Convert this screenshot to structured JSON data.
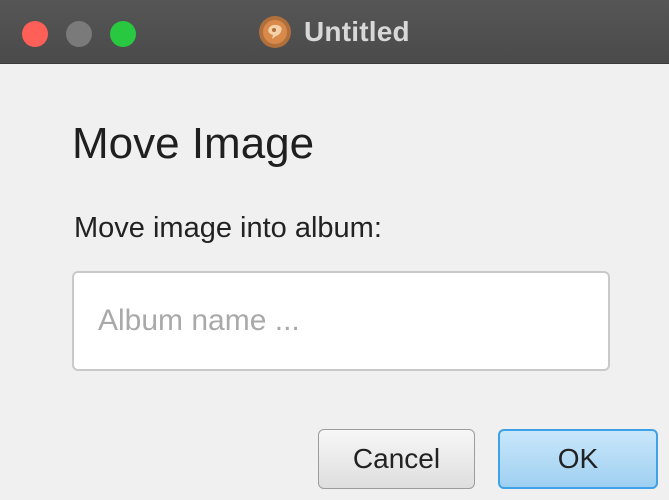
{
  "window": {
    "title": "Untitled",
    "app_icon": "app-logo-icon",
    "controls": [
      "close",
      "minimize",
      "zoom"
    ]
  },
  "dialog": {
    "heading": "Move Image",
    "prompt": "Move image into album:",
    "album_input": {
      "value": "",
      "placeholder": "Album name ..."
    },
    "buttons": {
      "cancel_label": "Cancel",
      "ok_label": "OK"
    }
  },
  "colors": {
    "titlebar": "#4f4f4f",
    "close": "#fe5f57",
    "zoom": "#28c840",
    "ok_border": "#3fa2e6"
  }
}
